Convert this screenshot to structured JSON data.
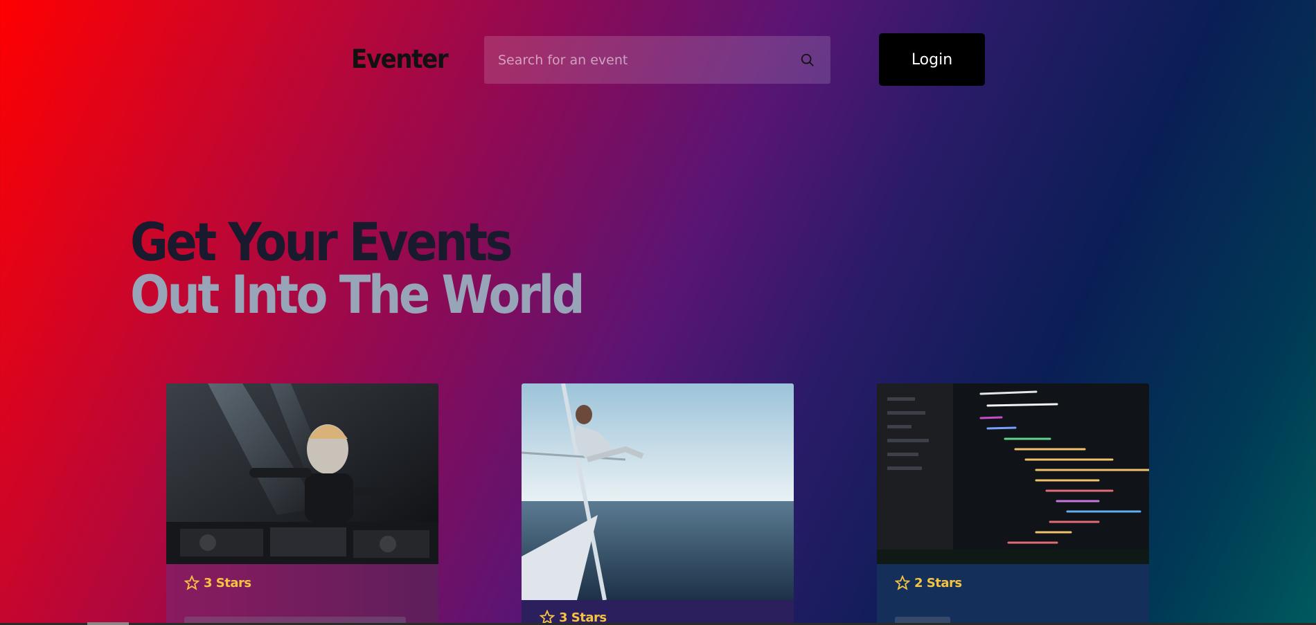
{
  "header": {
    "brand": "Eventer",
    "search_placeholder": "Search for an event",
    "login_label": "Login"
  },
  "hero": {
    "line1": "Get Your Events",
    "line2": "Out Into The World"
  },
  "cards": [
    {
      "stars_label": "3 Stars",
      "stars": 3,
      "image": "dj-performing-photo"
    },
    {
      "stars_label": "3 Stars",
      "stars": 3,
      "image": "woman-on-sailboat-photo"
    },
    {
      "stars_label": "2 Stars",
      "stars": 2,
      "image": "code-editor-screen-photo"
    }
  ],
  "colors": {
    "star": "#f6c342",
    "login_bg": "#000000"
  }
}
